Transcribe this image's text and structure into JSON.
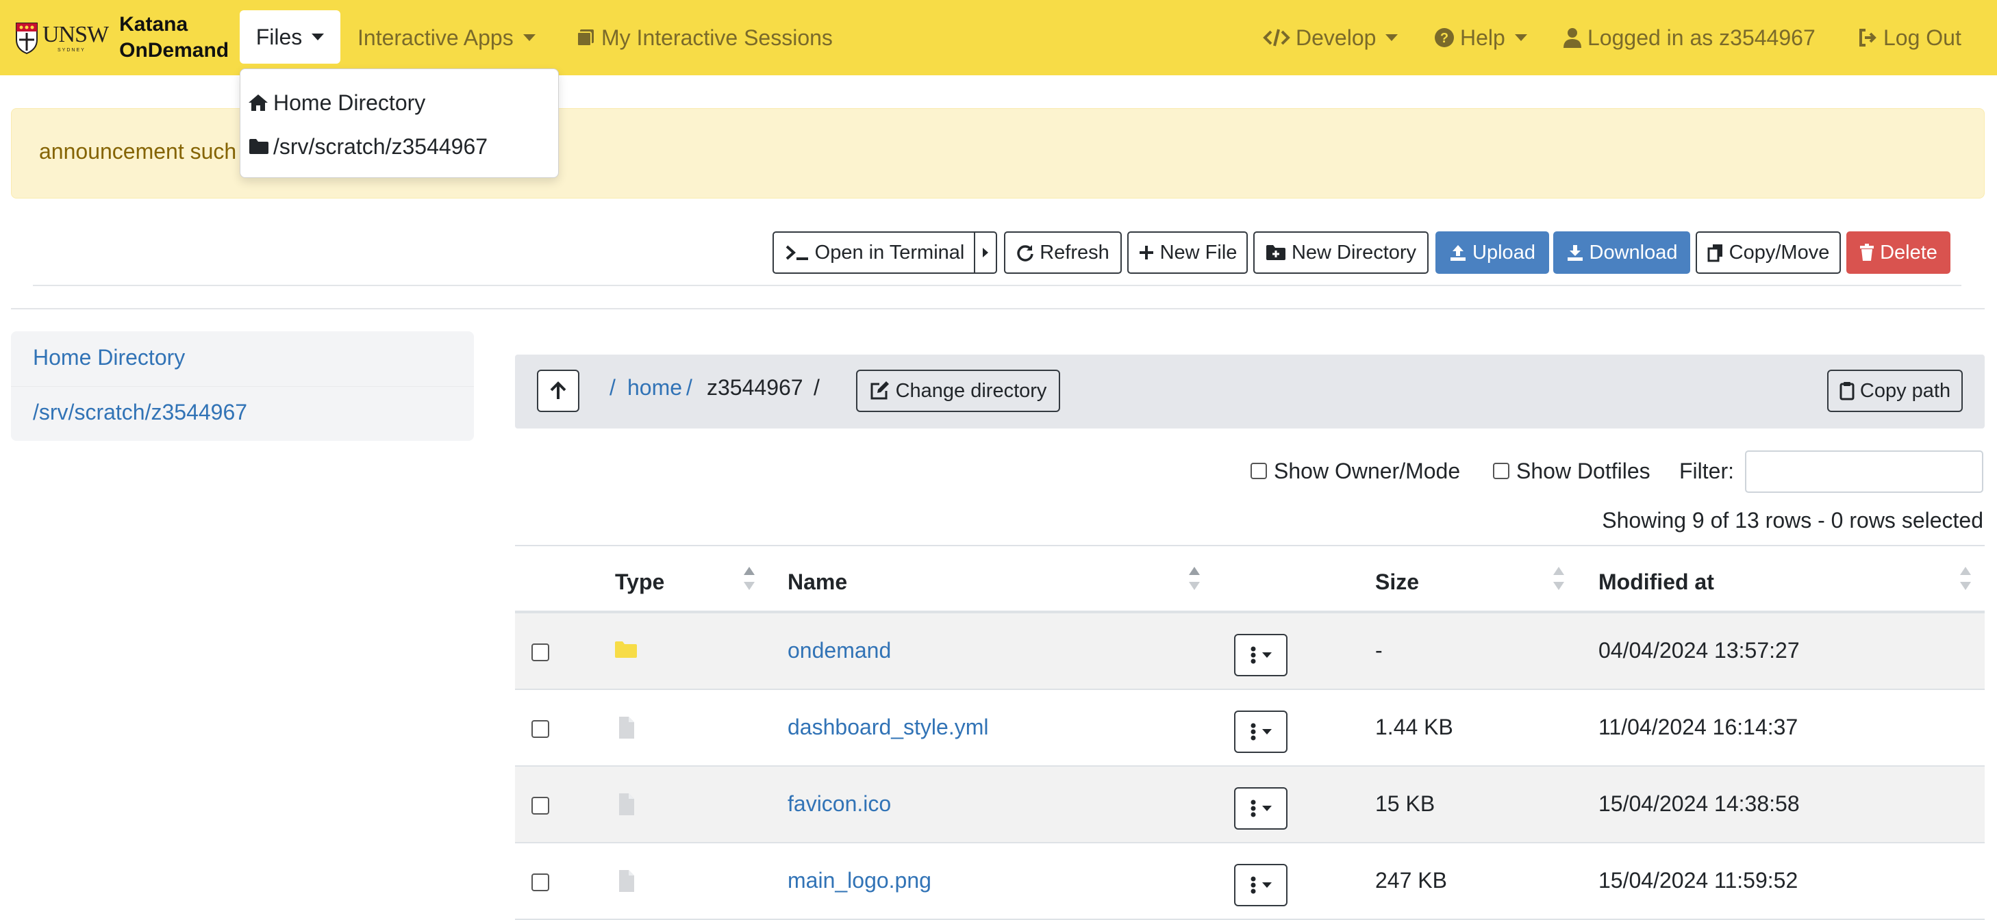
{
  "navbar": {
    "logo_text": "UNSW",
    "logo_subtext": "SYDNEY",
    "brand_line1": "Katana",
    "brand_line2": "OnDemand",
    "files_label": "Files",
    "interactive_apps_label": "Interactive Apps",
    "my_sessions_label": "My Interactive Sessions",
    "develop_label": "Develop",
    "help_label": "Help",
    "logged_in_label": "Logged in as z3544967",
    "logout_label": "Log Out",
    "accent_color": "#f7dc47"
  },
  "files_dropdown": {
    "items": [
      {
        "label": "Home Directory",
        "icon": "home-icon"
      },
      {
        "label": "/srv/scratch/z3544967",
        "icon": "folder-icon"
      }
    ]
  },
  "announcement": {
    "text": "announcement such"
  },
  "toolbar": {
    "open_terminal": "Open in Terminal",
    "refresh": "Refresh",
    "new_file": "New File",
    "new_directory": "New Directory",
    "upload": "Upload",
    "download": "Download",
    "copy_move": "Copy/Move",
    "delete": "Delete"
  },
  "favorites": {
    "items": [
      {
        "label": "Home Directory"
      },
      {
        "label": "/srv/scratch/z3544967"
      }
    ]
  },
  "breadcrumb": {
    "root": "/",
    "home": "home",
    "sep1": "/",
    "current": "z3544967",
    "sep2": "/",
    "change_directory": "Change directory",
    "copy_path": "Copy path"
  },
  "options": {
    "show_owner_mode": "Show Owner/Mode",
    "show_dotfiles": "Show Dotfiles",
    "filter_label": "Filter:",
    "filter_value": ""
  },
  "status": {
    "showing": "Showing 9 of 13 rows - 0 rows selected"
  },
  "table": {
    "headers": {
      "type": "Type",
      "name": "Name",
      "size": "Size",
      "modified": "Modified at"
    },
    "rows": [
      {
        "type": "folder",
        "name": "ondemand",
        "size": "-",
        "modified": "04/04/2024 13:57:27"
      },
      {
        "type": "file",
        "name": "dashboard_style.yml",
        "size": "1.44 KB",
        "modified": "11/04/2024 16:14:37"
      },
      {
        "type": "file",
        "name": "favicon.ico",
        "size": "15 KB",
        "modified": "15/04/2024 14:38:58"
      },
      {
        "type": "file",
        "name": "main_logo.png",
        "size": "247 KB",
        "modified": "15/04/2024 11:59:52"
      }
    ]
  },
  "colors": {
    "link": "#3173b6",
    "upload_download": "#4a81c1",
    "delete": "#d9534f",
    "folder_icon": "#f7dc47",
    "file_icon": "#d6d8db"
  }
}
